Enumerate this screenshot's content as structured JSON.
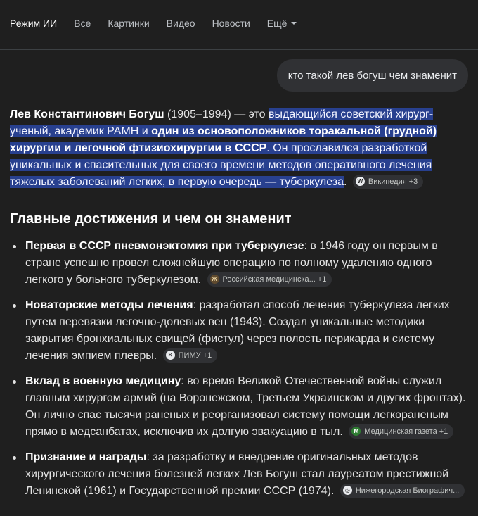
{
  "tabs": [
    {
      "label": "Режим ИИ",
      "active": true
    },
    {
      "label": "Все"
    },
    {
      "label": "Картинки"
    },
    {
      "label": "Видео"
    },
    {
      "label": "Новости"
    },
    {
      "label": "Ещё"
    }
  ],
  "query": "кто такой лев богуш чем знаменит",
  "intro": {
    "name": "Лев Константинович Богуш",
    "years": " (1905–1994) — это ",
    "hl_1": "выдающийся советский хирург-ученый, академик РАМН и ",
    "hl_bold": "один из основоположников торакальной (грудной) хирургии и легочной фтизиохирургии в СССР",
    "hl_2": ". Он прославился разработкой уникальных и спасительных для своего времени методов оперативного лечения тяжелых заболеваний легких, в первую очередь — туберкулеза",
    "after": ".",
    "source": "Википедия +3",
    "source_icon": "W"
  },
  "section_title": "Главные достижения и чем он знаменит",
  "items": [
    {
      "title": "Первая в СССР пневмонэктомия при туберкулезе",
      "text": ": в 1946 году он первым в стране успешно провел сложнейшую операцию по полному удалению одного легкого у больного туберкулезом.",
      "source": "Российская медицинска... +1"
    },
    {
      "title": "Новаторские методы лечения",
      "text": ": разработал способ лечения туберкулеза легких путем перевязки легочно-долевых вен (1943). Создал уникальные методики закрытия бронхиальных свищей (фистул) через полость перикарда и систему лечения эмпием плевры.",
      "source": "ПИМУ +1"
    },
    {
      "title": "Вклад в военную медицину",
      "text": ": во время Великой Отечественной войны служил главным хирургом армий (на Воронежском, Третьем Украинском и других фронтах). Он лично спас тысячи раненых и реорганизовал систему помощи легкораненым прямо в медсанбатах, исключив их долгую эвакуацию в тыл.",
      "source": "Медицинская газета +1"
    },
    {
      "title": "Признание и награды",
      "text": ": за разработку и внедрение оригинальных методов хирургического лечения болезней легких Лев Богуш стал лауреатом престижной Ленинской (1961) и Государственной премии СССР (1974).",
      "source": "Нижегородская Биографич..."
    }
  ]
}
